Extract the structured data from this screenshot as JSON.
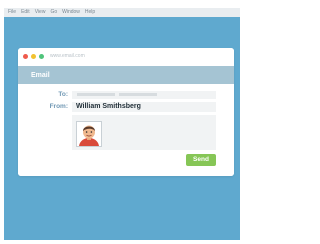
{
  "menubar": {
    "items": [
      "File",
      "Edit",
      "View",
      "Go",
      "Window",
      "Help"
    ]
  },
  "browser": {
    "url": "www.email.com"
  },
  "email": {
    "title": "Email",
    "to_label": "To:",
    "from_label": "From:",
    "from_value": "William Smithsberg",
    "send_label": "Send",
    "attachment_icon": "person-photo-icon"
  },
  "colors": {
    "desktop": "#5fa9cf",
    "header": "#a5c4d3",
    "label": "#6f97b3",
    "send_button": "#86c656",
    "close_dot": "#ef5b4c",
    "minimize_dot": "#f2c230",
    "maximize_dot": "#4fc47b"
  }
}
